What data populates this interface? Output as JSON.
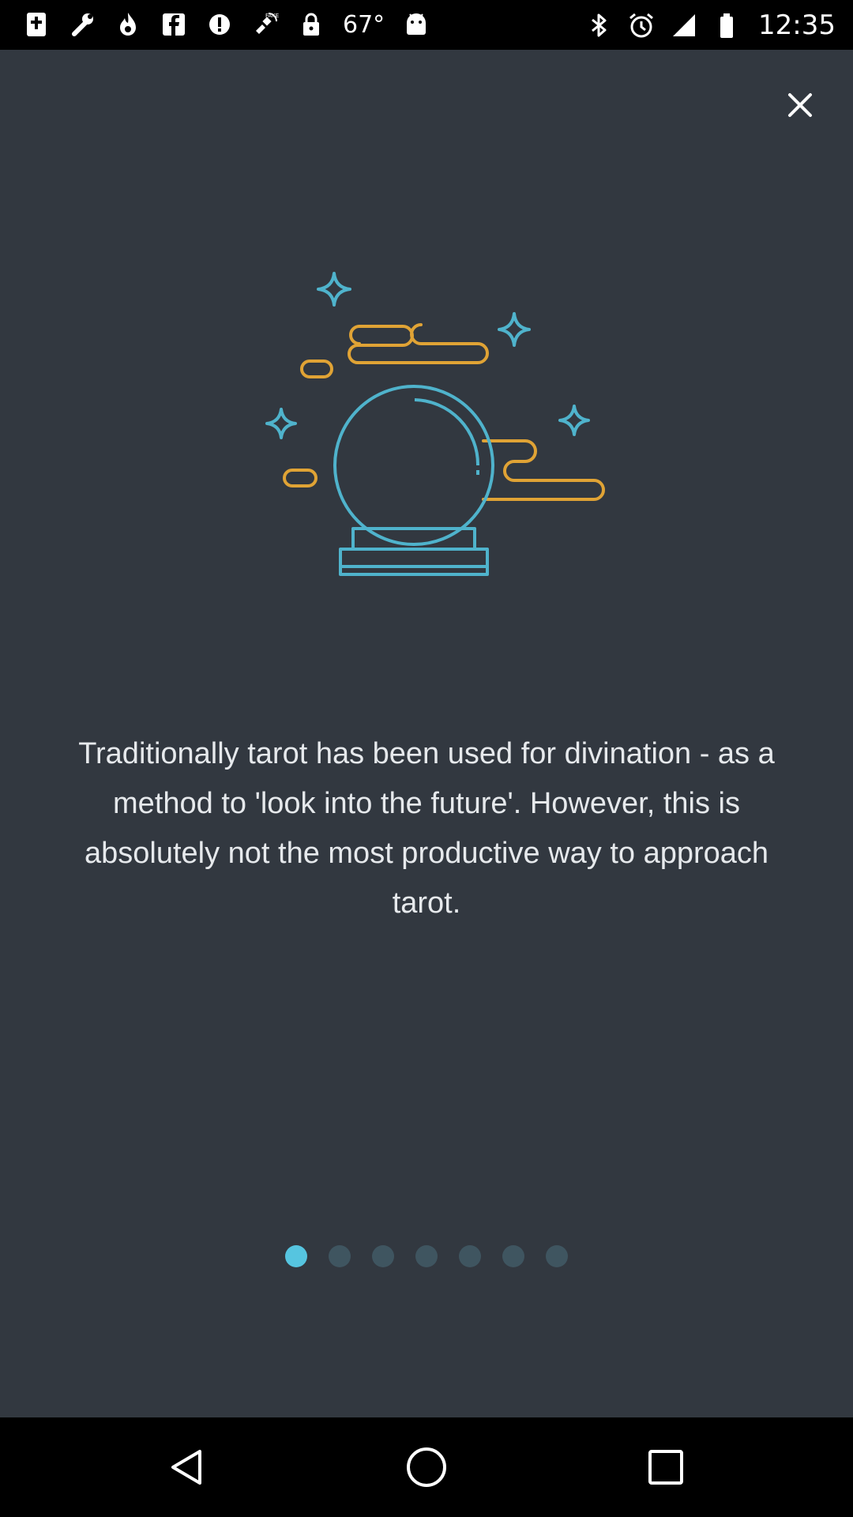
{
  "status_bar": {
    "left_icons": [
      "bible-app-icon",
      "wrench-icon",
      "flame-icon",
      "facebook-icon",
      "circle-alert-icon",
      "fake-gps-icon",
      "lock-icon"
    ],
    "temperature": "67°",
    "notification_icon": "android-icon",
    "right_icons": [
      "bluetooth-icon",
      "alarm-icon",
      "signal-icon",
      "battery-icon"
    ],
    "time": "12:35"
  },
  "onboarding": {
    "close_icon": "close-icon",
    "illustration": "crystal-ball-illustration",
    "description": "Traditionally tarot has been used for divination - as a method to 'look into the future'. However, this is absolutely not the most productive way to approach tarot.",
    "pager": {
      "total": 7,
      "active_index": 0
    },
    "colors": {
      "background": "#323840",
      "accent": "#56c5e0",
      "illustration_blue": "#4fb3cc",
      "illustration_orange": "#e0a335",
      "dot_inactive": "#3f5560"
    }
  },
  "nav_bar": {
    "buttons": [
      "back-icon",
      "home-icon",
      "recents-icon"
    ]
  }
}
